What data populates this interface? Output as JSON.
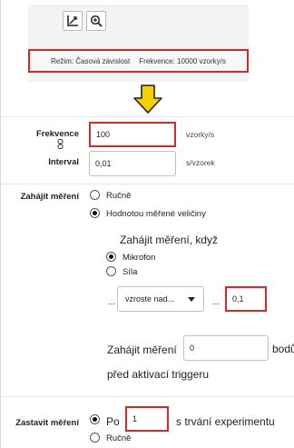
{
  "toolbar": {
    "chart_icon": "chart-axis-icon",
    "zoom_icon": "zoom-icon"
  },
  "status": {
    "mode": "Režim: Časová závislost",
    "frequency": "Frekvence: 10000 vzorky/s"
  },
  "arrow_color": "#f5d000",
  "highlight_color": "#d62828",
  "sampling": {
    "frequency_label": "Frekvence",
    "frequency_value": "100",
    "frequency_unit": "vzorky/s",
    "link_icon": "link-icon",
    "interval_label": "Interval",
    "interval_value": "0,01",
    "interval_unit": "s/vzorek"
  },
  "start": {
    "label": "Zahájit měření",
    "options": [
      "Ručně",
      "Hodnotou měřené veličiny"
    ],
    "selected": 1,
    "when_label": "Zahájit měření, když",
    "sources": [
      "Mikrofon",
      "Síla"
    ],
    "source_selected": 0,
    "dots1": "...",
    "condition": "vzroste nad...",
    "dots2": "...",
    "threshold": "0,1",
    "pre_label": "Zahájit měření",
    "pre_value": "0",
    "pre_unit": "bodů",
    "pre_suffix": "před aktivací triggeru"
  },
  "stop": {
    "label": "Zastavit měření",
    "option_after": "Po",
    "after_value": "1",
    "after_unit": "s trvání experimentu",
    "option_manual": "Ručně",
    "selected": 0
  }
}
